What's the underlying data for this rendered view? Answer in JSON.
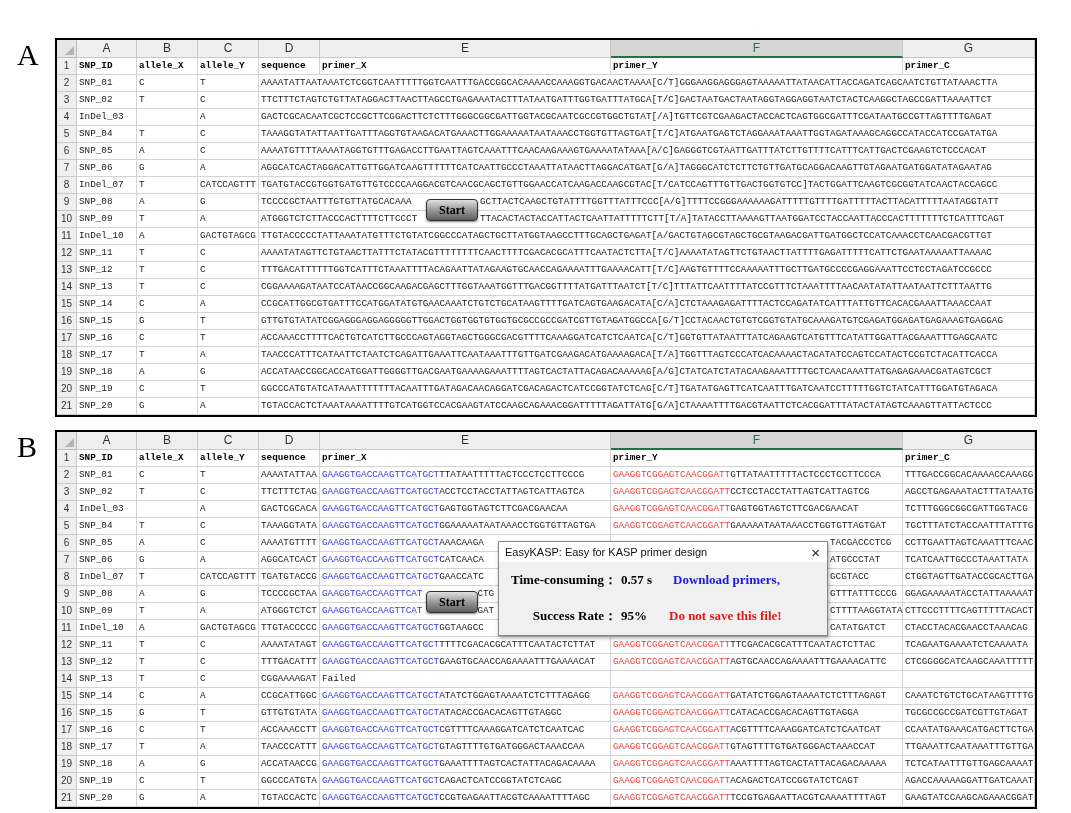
{
  "panels": [
    {
      "label": "A",
      "kind": "sequences",
      "start_button": "Start",
      "columns": [
        {
          "letter": "A",
          "selected": false
        },
        {
          "letter": "B",
          "selected": false
        },
        {
          "letter": "C",
          "selected": false
        },
        {
          "letter": "D",
          "selected": false
        },
        {
          "letter": "E",
          "selected": false
        },
        {
          "letter": "F",
          "selected": true
        },
        {
          "letter": "G",
          "selected": false
        }
      ],
      "header": {
        "number": "1",
        "cells": [
          "SNP_ID",
          "allele_X",
          "allele_Y",
          "sequence",
          "primer_X",
          "primer_Y",
          "primer_C"
        ]
      },
      "rows": [
        {
          "number": "2",
          "snp_id": "SNP_01",
          "allele_x": "C",
          "allele_y": "T",
          "sequence": [
            "AAAATATTAATAAATCTCGGTCAATTTTTGGTCAATTTGACCGGCACAAAACCAAAGGTGACAACTAAAA[C/T]GGGAAGGAGGGAGTAAAAATTATAACATTACCAGATCAGCAATCTGTTATAAACTTA"
          ]
        },
        {
          "number": "3",
          "snp_id": "SNP_02",
          "allele_x": "T",
          "allele_y": "C",
          "sequence": [
            "TTCTTTCTAGTCTGTTATAGGACTTAACTTAGCCTGAGAAATACTTTATAATGATTTGGTGATTTATGCA[T/C]GACTAATGACTAATAGGTAGGAGGTAATCTACTCAAGGCTAGCCGATTAAAATTCT"
          ]
        },
        {
          "number": "4",
          "snp_id": "InDel_03",
          "allele_y": "A",
          "sequence": [
            "GACTCGCACAATCGCTCCGCTTCGGACTTCTCTTTGGGCGGCGATTGGTACGCAATCGCCGTGGCTGTAT[/A]TGTTCGTCGAAGACTACCACTCAGTGGCGATTTCGATAATGCCGTTAGTTTTGAGAT"
          ]
        },
        {
          "number": "5",
          "snp_id": "SNP_04",
          "allele_x": "T",
          "allele_y": "C",
          "sequence": [
            "TAAAGGTATATTAATTGATTTAGGTGTAAGACATGAAACTTGGAAAAATAATAAACCTGGTGTTAGTGAT[T/C]ATGAATGAGTCTAGGAAATAAATTGGTAGATAAAGCAGGCCATACCATCCGATATGA"
          ]
        },
        {
          "number": "6",
          "snp_id": "SNP_05",
          "allele_x": "A",
          "allele_y": "C",
          "sequence": [
            "AAAATGTTTTAAAATAGGTGTTTGAGACCTTGAATTAGTCAAATTTCAACAAGAAAGTGAAAATATAAA[A/C]GAGGGTCGTAATTGATTTATCTTGTTTTCATTTCATTGACTCGAAGTCTCCCACAT"
          ]
        },
        {
          "number": "7",
          "snp_id": "SNP_06",
          "allele_x": "G",
          "allele_y": "A",
          "sequence": [
            "AGGCATCACTAGGACATTGTTGGATCAAGTTTTTTCATCAATTGCCCTAAATTATAACTTAGGACATGAT[G/A]TAGGGCATCTCTTCTGTTGATGCAGGACAAGTTGTAGAATGATGGATATAGAATAG"
          ]
        },
        {
          "number": "8",
          "snp_id": "InDel_07",
          "allele_x": "T",
          "allele_y": "CATCCAGTTT",
          "sequence": [
            "TGATGTACCGTGGTGATGTTGTCCCCAAGGACGTCAACGCAGCTGTTGGAACCATCAAGACCAAGCGTAC[T/CATCCAGTTTGTTGACTGGTGTCC]TACTGGATTCAAGTCGCGGTATCAACTACCAGCC"
          ]
        },
        {
          "number": "9",
          "snp_id": "SNP_08",
          "allele_x": "A",
          "allele_y": "G",
          "sequence": [
            "TCCCCGCTAATTTGTGTTATGCACAAA",
            "GCTTACTCAAGCTGTATTTTGGTTTATTTCCC[A/G]TTTTCCGGGAAAAAAGATTTTTGTTTTGATTTTTACTTACATTTTTAATAGGTATT"
          ]
        },
        {
          "number": "10",
          "snp_id": "SNP_09",
          "allele_x": "T",
          "allele_y": "A",
          "sequence": [
            "ATGGGTCTCTTACCCACTTTTCTTCCCT",
            "TTACACTACTACCATTACTCAATTATTTTTCTT[T/A]TATACCTTAAAAGTTAATGGATCCTACCAATTACCCACTTTTTTTCTCATTTCAGT"
          ]
        },
        {
          "number": "11",
          "snp_id": "InDel_10",
          "allele_x": "A",
          "allele_y": "GACTGTAGCG",
          "sequence": [
            "TTGTACCCCCTATTAAATATGTTTCTGTATCGGCCCATAGCTGCTTATGGTAAGCCTTTGCAGCTGAGAT[A/GACTGTAGCGTAGCTGCGTAAGACGATTGATGGCTCCATCAAACCTCAACGACGTTGT"
          ]
        },
        {
          "number": "12",
          "snp_id": "SNP_11",
          "allele_x": "T",
          "allele_y": "C",
          "sequence": [
            "AAAATATAGTTCTGTAACTTATTTCTATACGTTTTTTTTCAACTTTTCGACACGCATTTCAATACTCTTA[T/C]AAAATATAGTTCTGTAACTTATTTTGAGATTTTTCATTCTGAATAAAAATTAAAAC"
          ]
        },
        {
          "number": "13",
          "snp_id": "SNP_12",
          "allele_x": "T",
          "allele_y": "C",
          "sequence": [
            "TTTGACATTTTTTGGTCATTTCTAAATTTTACAGAATTATAGAAGTGCAACCAGAAAATTTGAAAACATT[T/C]AAGTGTTTTCCAAAAATTTGCTTGATGCCCCGAGGAAATTCCTCCTAGATCCGCCC"
          ]
        },
        {
          "number": "14",
          "snp_id": "SNP_13",
          "allele_x": "T",
          "allele_y": "C",
          "sequence": [
            "CGGAAAAGATAATCCATAACCGGCAAGACGAGCTTTGGTAAATGGTTTGACGGTTTTATGATTTAATCT[T/C]TTTATTCAATTTTATCCGTTTCTAAATTTTAACAATATATTAATAATTCTTTAATTG"
          ]
        },
        {
          "number": "15",
          "snp_id": "SNP_14",
          "allele_x": "C",
          "allele_y": "A",
          "sequence": [
            "CCGCATTGGCGTGATTTCCATGGATATGTGAACAAATCTGTCTGCATAAGTTTTGATCAGTGAAGACATA[C/A]CTCTAAAGAGATTTTACTCCAGATATCATTTATTGTTCACACGAAATTAAACCAAT"
          ]
        },
        {
          "number": "16",
          "snp_id": "SNP_15",
          "allele_x": "G",
          "allele_y": "T",
          "sequence": [
            "GTTGTGTATATCGGAGGGAGGAGGGGGTTGGACTGGTGGTGTGGTGCGCCGCCGATCGTTGTAGATGGCCA[G/T]CCTACAACTGTGTCGGTGTATGCAAAGATGTCGAGATGGAGATGAGAAAGTGAGGAG"
          ]
        },
        {
          "number": "17",
          "snp_id": "SNP_16",
          "allele_x": "C",
          "allele_y": "T",
          "sequence": [
            "ACCAAACCTTTTCACTGTCATCTTGCCCAGTAGGTAGCTGGGCGACGTTTTCAAAGGATCATCTCAATCA[C/T]GGTGTTATAATTTATCAGAAGTCATGTTTCATATTGGATTACGAAATTTGAGCAATC"
          ]
        },
        {
          "number": "18",
          "snp_id": "SNP_17",
          "allele_x": "T",
          "allele_y": "A",
          "sequence": [
            "TAACCCATTTCATAATTCTAATCTCAGATTGAAATTCAATAAATTTGTTGATCGAAGACATGAAAAGACA[T/A]TGGTTTAGTCCCATCACAAAACTACATATCCAGTCCATACTCCGTCTACATTCACCA"
          ]
        },
        {
          "number": "19",
          "snp_id": "SNP_18",
          "allele_x": "A",
          "allele_y": "G",
          "sequence": [
            "ACCATAACCGGCACCATGGATTGGGGTTGACGAATGAAAAGAAATTTTAGTCACTATTACAGACAAAAAG[A/G]CTATCATCTATACAAGAAATTTTGCTCAACAAATTATGAGAGAAACGATAGTCGCT"
          ]
        },
        {
          "number": "20",
          "snp_id": "SNP_19",
          "allele_x": "C",
          "allele_y": "T",
          "sequence": [
            "GGCCCATGTATCATAAATTTTTTTACAATTTGATAGACAACAGGATCGACAGACTCATCCGGTATCTCAG[C/T]TGATATGAGTTCATCAATTTGATCAATCCTTTTTGGTCTATCATTTGGATGTAGACA"
          ]
        },
        {
          "number": "21",
          "snp_id": "SNP_20",
          "allele_x": "G",
          "allele_y": "A",
          "sequence": [
            "TGTACCACTCTAAATAAAATTTTGTCATGGTCCACGAAGTATCCAAGCAGAAACGGATTTTTAGATTATG[G/A]CTAAAATTTTGACGTAATTCTCACGGATTTATACTATAGTCAAAGTTATTACTCCC"
          ]
        }
      ]
    },
    {
      "label": "B",
      "kind": "primers",
      "start_button": "Start",
      "columns": [
        {
          "letter": "A",
          "selected": false
        },
        {
          "letter": "B",
          "selected": false
        },
        {
          "letter": "C",
          "selected": false
        },
        {
          "letter": "D",
          "selected": false
        },
        {
          "letter": "E",
          "selected": false
        },
        {
          "letter": "F",
          "selected": true
        },
        {
          "letter": "G",
          "selected": false
        }
      ],
      "header": {
        "number": "1",
        "cells": [
          "SNP_ID",
          "allele_X",
          "allele_Y",
          "sequence",
          "primer_X",
          "primer_Y",
          "primer_C"
        ]
      },
      "rows": [
        {
          "number": "2",
          "snp_id": "SNP_01",
          "allele_x": "C",
          "allele_y": "T",
          "sequence": "AAAATATTAA",
          "primer_x": {
            "primer": "GAAGGTGACCAAGTTCATGCT",
            "tail": "TTATAATTTTTACTCCCTCCTTCCCG"
          },
          "primer_y": {
            "primer": "GAAGGTCGGAGTCAACGGATT",
            "tail": "GTTATAATTTTTACTCCCTCCTTCCCA",
            "covered": false
          },
          "primer_c": "TTTGACCGGCACAAAACCAAAGG"
        },
        {
          "number": "3",
          "snp_id": "SNP_02",
          "allele_x": "T",
          "allele_y": "C",
          "sequence": "TTCTTTCTAG",
          "primer_x": {
            "primer": "GAAGGTGACCAAGTTCATGCT",
            "tail": "ACCTCCTACCTATTAGTCATTAGTCA"
          },
          "primer_y": {
            "primer": "GAAGGTCGGAGTCAACGGATT",
            "tail": "CCTCCTACCTATTAGTCATTAGTCG",
            "covered": false
          },
          "primer_c": "AGCCTGAGAAATACTTTATAATG"
        },
        {
          "number": "4",
          "snp_id": "InDel_03",
          "allele_y": "A",
          "sequence": "GACTCGCACA",
          "primer_x": {
            "primer": "GAAGGTGACCAAGTTCATGCT",
            "tail": "GAGTGGTAGTCTTCGACGAACAA"
          },
          "primer_y": {
            "primer": "GAAGGTCGGAGTCAACGGATT",
            "tail": "GAGTGGTAGTCTTCGACGAACAT",
            "covered": false
          },
          "primer_c": "TCTTTGGGCGGCGATTGGTACG"
        },
        {
          "number": "5",
          "snp_id": "SNP_04",
          "allele_x": "T",
          "allele_y": "C",
          "sequence": "TAAAGGTATA",
          "primer_x": {
            "primer": "GAAGGTGACCAAGTTCATGCT",
            "tail": "GGAAAAATAATAAACCTGGTGTTAGTGA"
          },
          "primer_y": {
            "primer": "GAAGGTCGGAGTCAACGGATT",
            "tail": "GAAAAATAATAAACCTGGTGTTAGTGAT",
            "covered": false
          },
          "primer_c": "TGCTTTATCTACCAATTTATTTG"
        },
        {
          "number": "6",
          "snp_id": "SNP_05",
          "allele_x": "A",
          "allele_y": "C",
          "sequence": "AAAATGTTTT",
          "primer_x": {
            "primer": "GAAGGTGACCAAGTTCATGCT",
            "tail": "AAACAAGA"
          },
          "primer_y": {
            "tail": "TACGACCCTCG",
            "covered": true
          },
          "primer_c": "CCTTGAATTAGTCAAATTTCAAC"
        },
        {
          "number": "7",
          "snp_id": "SNP_06",
          "allele_x": "G",
          "allele_y": "A",
          "sequence": "AGGCATCACT",
          "primer_x": {
            "primer": "GAAGGTGACCAAGTTCATGCT",
            "tail": "CATCAACA"
          },
          "primer_y": {
            "tail": "ATGCCCTAT",
            "covered": true
          },
          "primer_c": "TCATCAATTGCCCTAAATTATA"
        },
        {
          "number": "8",
          "snp_id": "InDel_07",
          "allele_x": "T",
          "allele_y": "CATCCAGTTT",
          "sequence": "TGATGTACCG",
          "primer_x": {
            "primer": "GAAGGTGACCAAGTTCATGCT",
            "tail": "GAACCATC"
          },
          "primer_y": {
            "tail": "GCGTACC",
            "covered": true
          },
          "primer_c": "CTGGTAGTTGATACCGCACTTGA"
        },
        {
          "number": "9",
          "snp_id": "SNP_08",
          "allele_x": "A",
          "allele_y": "G",
          "sequence": "TCCCCGCTAA",
          "primer_x": {
            "primer": "GAAGGTGACCAAGTTCAT",
            "after_button": "CTG"
          },
          "primer_y": {
            "tail": "GTTTATTTCCCG",
            "covered": true
          },
          "primer_c": "GGAGAAAAATACCTATTAAAAAT"
        },
        {
          "number": "10",
          "snp_id": "SNP_09",
          "allele_x": "T",
          "allele_y": "A",
          "sequence": "ATGGGTCTCT",
          "primer_x": {
            "primer": "GAAGGTGACCAAGTTCAT",
            "after_button": "GAT"
          },
          "primer_y": {
            "tail": "CTTTTAAGGTATA",
            "covered": true
          },
          "primer_c": "CTTCCCTTTTCAGTTTTTACACT"
        },
        {
          "number": "11",
          "snp_id": "InDel_10",
          "allele_x": "A",
          "allele_y": "GACTGTAGCG",
          "sequence": "TTGTACCCCC",
          "primer_x": {
            "primer": "GAAGGTGACCAAGTTCATGCT",
            "tail": "GGTAAGCC"
          },
          "primer_y": {
            "tail": "CATATGATCT",
            "covered": true
          },
          "primer_c": "CTACCTACACGAACCTAAACAG"
        },
        {
          "number": "12",
          "snp_id": "SNP_11",
          "allele_x": "T",
          "allele_y": "C",
          "sequence": "AAAATATAGT",
          "primer_x": {
            "primer": "GAAGGTGACCAAGTTCATGCT",
            "tail": "TTTTCGACACGCATTTCAATACTCTTAT"
          },
          "primer_y": {
            "primer": "GAAGGTCGGAGTCAACGGATT",
            "tail": "TTCGACACGCATTTCAATACTCTTAC",
            "covered": false
          },
          "primer_c": "TCAGAATGAAAATCTCAAAATA"
        },
        {
          "number": "13",
          "snp_id": "SNP_12",
          "allele_x": "T",
          "allele_y": "C",
          "sequence": "TTTGACATTT",
          "primer_x": {
            "primer": "GAAGGTGACCAAGTTCATGCT",
            "tail": "GAAGTGCAACCAGAAAATTTGAAAACAT"
          },
          "primer_y": {
            "primer": "GAAGGTCGGAGTCAACGGATT",
            "tail": "AGTGCAACCAGAAAATTTGAAAACATTC",
            "covered": false
          },
          "primer_c": "CTCGGGGCATCAAGCAAATTTTT"
        },
        {
          "number": "14",
          "snp_id": "SNP_13",
          "allele_x": "T",
          "allele_y": "C",
          "sequence": "CGGAAAAGAT",
          "primer_x": {
            "tail": "Failed"
          }
        },
        {
          "number": "15",
          "snp_id": "SNP_14",
          "allele_x": "C",
          "allele_y": "A",
          "sequence": "CCGCATTGGC",
          "primer_x": {
            "primer": "GAAGGTGACCAAGTTCATGCT",
            "tail": "ATATCTGGAGTAAAATCTCTTTAGAGG"
          },
          "primer_y": {
            "primer": "GAAGGTCGGAGTCAACGGATT",
            "tail": "GATATCTGGAGTAAAATCTCTTTAGAGT",
            "covered": false
          },
          "primer_c": "CAAATCTGTCTGCATAAGTTTTG"
        },
        {
          "number": "16",
          "snp_id": "SNP_15",
          "allele_x": "G",
          "allele_y": "T",
          "sequence": "GTTGTGTATA",
          "primer_x": {
            "primer": "GAAGGTGACCAAGTTCATGCT",
            "tail": "ATACACCGACACAGTTGTAGGC"
          },
          "primer_y": {
            "primer": "GAAGGTCGGAGTCAACGGATT",
            "tail": "CATACACCGACACAGTTGTAGGA",
            "covered": false
          },
          "primer_c": "TGCGCCGCCGATCGTTGTAGAT"
        },
        {
          "number": "17",
          "snp_id": "SNP_16",
          "allele_x": "C",
          "allele_y": "T",
          "sequence": "ACCAAACCTT",
          "primer_x": {
            "primer": "GAAGGTGACCAAGTTCATGCT",
            "tail": "CGTTTTCAAAGGATCATCTCAATCAC"
          },
          "primer_y": {
            "primer": "GAAGGTCGGAGTCAACGGATT",
            "tail": "ACGTTTTCAAAGGATCATCTCAATCAT",
            "covered": false
          },
          "primer_c": "CCAATATGAAACATGACTTCTGA"
        },
        {
          "number": "18",
          "snp_id": "SNP_17",
          "allele_x": "T",
          "allele_y": "A",
          "sequence": "TAACCCATTT",
          "primer_x": {
            "primer": "GAAGGTGACCAAGTTCATGCT",
            "tail": "GTAGTTTTGTGATGGGACTAAACCAA"
          },
          "primer_y": {
            "primer": "GAAGGTCGGAGTCAACGGATT",
            "tail": "GTAGTTTTGTGATGGGACTAAACCAT",
            "covered": false
          },
          "primer_c": "TTGAAATTCAATAAATTTGTTGA"
        },
        {
          "number": "19",
          "snp_id": "SNP_18",
          "allele_x": "A",
          "allele_y": "G",
          "sequence": "ACCATAACCG",
          "primer_x": {
            "primer": "GAAGGTGACCAAGTTCATGCT",
            "tail": "GAAATTTTAGTCACTATTACAGACAAAA"
          },
          "primer_y": {
            "primer": "GAAGGTCGGAGTCAACGGATT",
            "tail": "AAATTTTAGTCACTATTACAGACAAAAA",
            "covered": false
          },
          "primer_c": "TCTCATAATTTGTTGAGCAAAAT"
        },
        {
          "number": "20",
          "snp_id": "SNP_19",
          "allele_x": "C",
          "allele_y": "T",
          "sequence": "GGCCCATGTA",
          "primer_x": {
            "primer": "GAAGGTGACCAAGTTCATGCT",
            "tail": "CAGACTCATCCGGTATCTCAGC"
          },
          "primer_y": {
            "primer": "GAAGGTCGGAGTCAACGGATT",
            "tail": "ACAGACTCATCCGGTATCTCAGT",
            "covered": false
          },
          "primer_c": "AGACCAAAAAGGATTGATCAAAT"
        },
        {
          "number": "21",
          "snp_id": "SNP_20",
          "allele_x": "G",
          "allele_y": "A",
          "sequence": "TGTACCACTC",
          "primer_x": {
            "primer": "GAAGGTGACCAAGTTCATGCT",
            "tail": "CCGTGAGAATTACGTCAAAATTTTAGC"
          },
          "primer_y": {
            "primer": "GAAGGTCGGAGTCAACGGATT",
            "tail": "TCCGTGAGAATTACGTCAAAATTTTAGT",
            "covered": false
          },
          "primer_c": "GAAGTATCCAAGCAGAAACGGAT"
        }
      ],
      "dialog": {
        "title": "EasyKASP: Easy for KASP primer design",
        "close": "×",
        "time_label": "Time-consuming：",
        "time_value": "0.57 s",
        "download_link": "Download primers,",
        "rate_label": "Success Rate：",
        "rate_value": "95%",
        "warning": "Do not save this file!"
      }
    }
  ]
}
